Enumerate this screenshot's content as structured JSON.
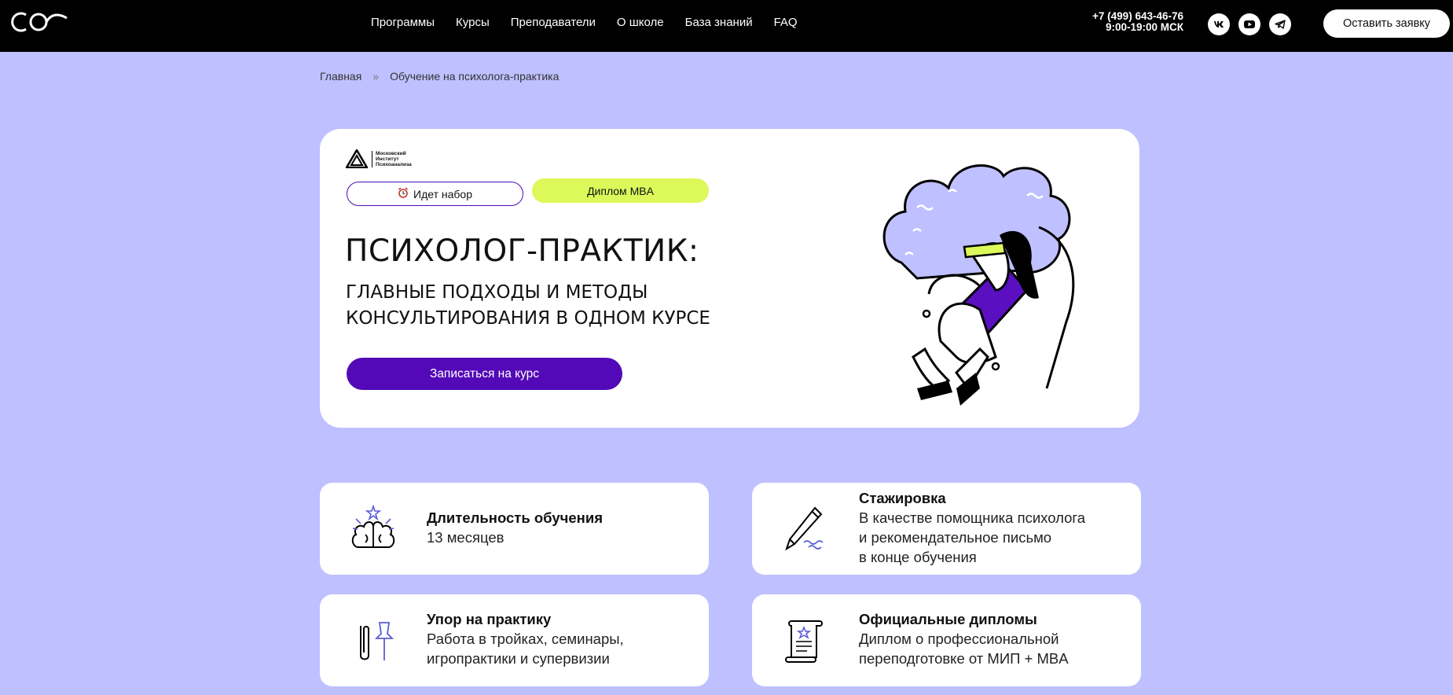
{
  "header": {
    "nav": [
      "Программы",
      "Курсы",
      "Преподаватели",
      "О школе",
      "База знаний",
      "FAQ"
    ],
    "phone": "+7 (499) 643-46-76",
    "hours": "9:00-19:00 МСК",
    "socials": [
      "vk-icon",
      "youtube-icon",
      "telegram-icon"
    ],
    "cta": "Оставить заявку"
  },
  "breadcrumb": {
    "home": "Главная",
    "separator": "»",
    "current": "Обучение на психолога-практика"
  },
  "hero": {
    "institute_logo_text": "Московский Институт Психоанализа",
    "badge_recruit": "Идет набор",
    "badge_mba": "Диплом MBA",
    "title": "ПСИХОЛОГ-ПРАКТИК:",
    "subtitle_line1": "ГЛАВНЫЕ ПОДХОДЫ И МЕТОДЫ",
    "subtitle_line2": "КОНСУЛЬТИРОВАНИЯ В ОДНОМ КУРСЕ",
    "button": "Записаться на курс"
  },
  "features": [
    {
      "title": "Длительность обучения",
      "lines": [
        "13 месяцев"
      ],
      "icon": "brain-icon"
    },
    {
      "title": "Стажировка",
      "lines": [
        "В качестве помощника психолога",
        "и рекомендательное письмо",
        "в конце обучения"
      ],
      "icon": "pen-icon"
    },
    {
      "title": "Упор на практику",
      "lines": [
        "Работа в тройках, семинары,",
        "игропрактики и супервизии"
      ],
      "icon": "paperclip-pin-icon"
    },
    {
      "title": "Официальные дипломы",
      "lines": [
        "Диплом о профессиональной",
        "переподготовке от МИП + MBA"
      ],
      "icon": "diploma-scroll-icon"
    }
  ],
  "colors": {
    "background": "#bfc0ff",
    "header": "#000000",
    "primary_button": "#5309b7",
    "badge_lime": "#dcf85a",
    "card": "#ffffff"
  }
}
